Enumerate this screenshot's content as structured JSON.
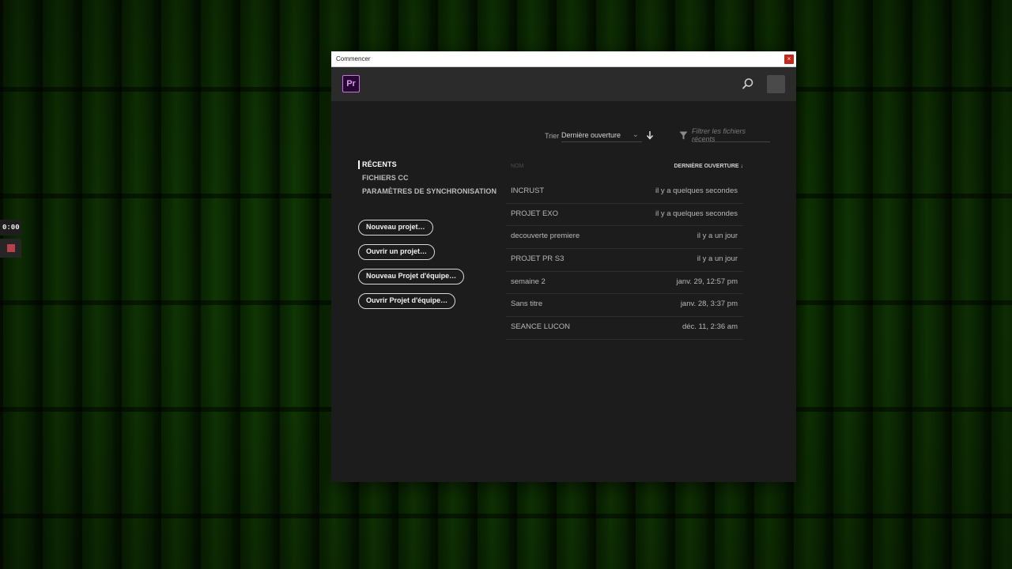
{
  "recorder": {
    "time": "0:00"
  },
  "window": {
    "title": "Commencer",
    "close_glyph": "×"
  },
  "header": {
    "logo_text": "Pr"
  },
  "toolbar": {
    "sort_label": "Trier",
    "sort_value": "Dernière ouverture",
    "filter_placeholder": "Filtrer les fichiers récents"
  },
  "nav": {
    "items": [
      {
        "label": "RÉCENTS",
        "active": true
      },
      {
        "label": "FICHIERS CC",
        "active": false
      },
      {
        "label": "PARAMÈTRES DE SYNCHRONISATION",
        "active": false
      }
    ]
  },
  "actions": {
    "new_project": "Nouveau projet…",
    "open_project": "Ouvrir un projet…",
    "new_team_project": "Nouveau Projet d'équipe…",
    "open_team_project": "Ouvrir Projet d'équipe…"
  },
  "recent": {
    "col_name": "NOM",
    "col_date": "DERNIÈRE OUVERTURE ↓",
    "rows": [
      {
        "name": "INCRUST",
        "date": "il y a quelques secondes"
      },
      {
        "name": "PROJET EXO",
        "date": "il y a quelques secondes"
      },
      {
        "name": "decouverte premiere",
        "date": "il y a un jour"
      },
      {
        "name": "PROJET PR S3",
        "date": "il y a un jour"
      },
      {
        "name": "semaine 2",
        "date": "janv. 29, 12:57 pm"
      },
      {
        "name": "Sans titre",
        "date": "janv. 28, 3:37 pm"
      },
      {
        "name": "SEANCE LUCON",
        "date": "déc. 11, 2:36 am"
      }
    ]
  },
  "colors": {
    "accent_premiere": "#c377e0",
    "window_bg": "#1c1c1c",
    "header_bg": "#2b2b2b"
  }
}
